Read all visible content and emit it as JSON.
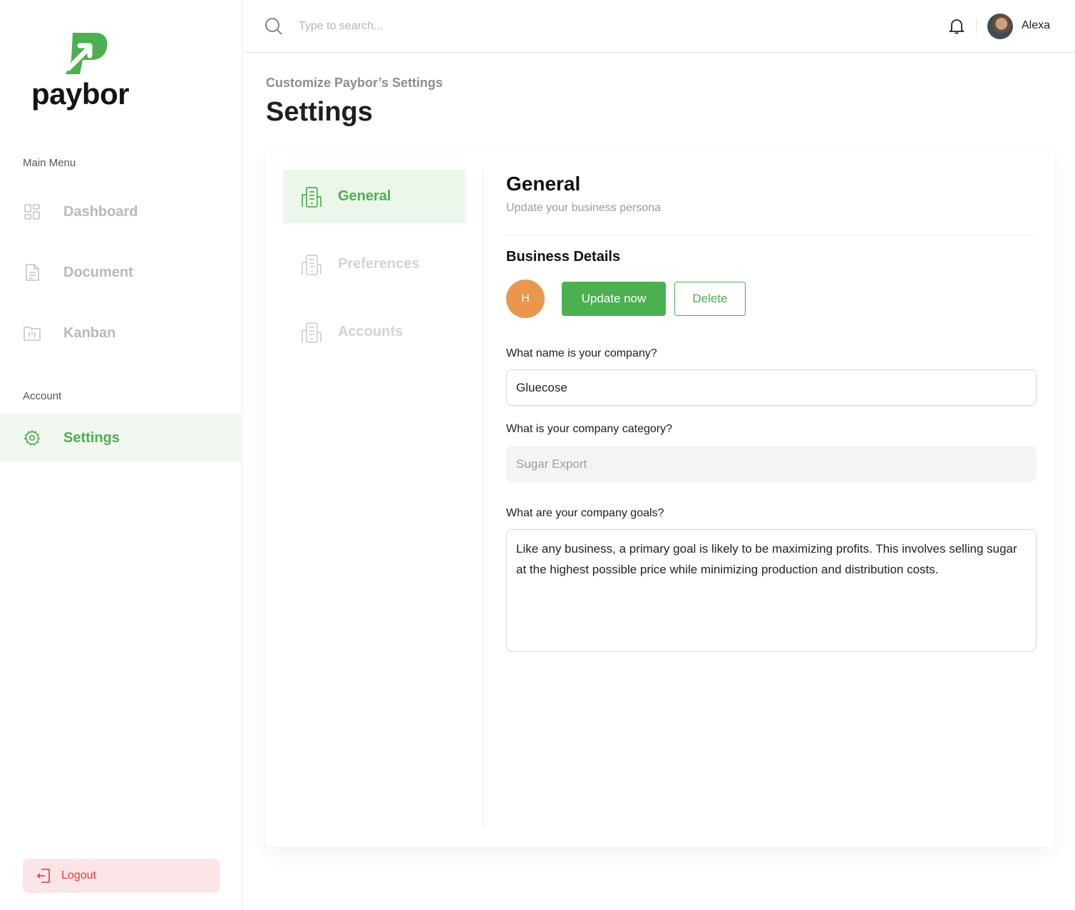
{
  "brand": {
    "name": "paybor",
    "accent": "#4caf50",
    "logout_color": "#e03a3a"
  },
  "sidebar": {
    "main_menu_label": "Main Menu",
    "account_label": "Account",
    "items": [
      {
        "label": "Dashboard",
        "icon": "dashboard-icon",
        "active": false
      },
      {
        "label": "Document",
        "icon": "document-icon",
        "active": false
      },
      {
        "label": "Kanban",
        "icon": "kanban-icon",
        "active": false
      }
    ],
    "account_items": [
      {
        "label": "Settings",
        "icon": "gear-icon",
        "active": true
      }
    ],
    "logout_label": "Logout"
  },
  "topbar": {
    "search_placeholder": "Type to search...",
    "user_name": "Alexa"
  },
  "header": {
    "subtitle": "Customize Paybor’s Settings",
    "title": "Settings"
  },
  "settings_nav": {
    "tabs": [
      {
        "label": "General",
        "active": true
      },
      {
        "label": "Preferences",
        "active": false
      },
      {
        "label": "Accounts",
        "active": false
      }
    ]
  },
  "general": {
    "title": "General",
    "subtitle": "Update your business persona",
    "section_title": "Business Details",
    "avatar_letter": "H",
    "update_label": "Update now",
    "delete_label": "Delete",
    "company_name_question": "What name is your company?",
    "company_name_value": "Gluecose",
    "category_question": "What is your company category?",
    "category_value": "Sugar Export",
    "goals_question": "What are your company goals?",
    "goals_value": "Like any business, a primary goal is likely to be maximizing profits. This involves selling sugar at the highest possible price while minimizing production and distribution costs."
  }
}
